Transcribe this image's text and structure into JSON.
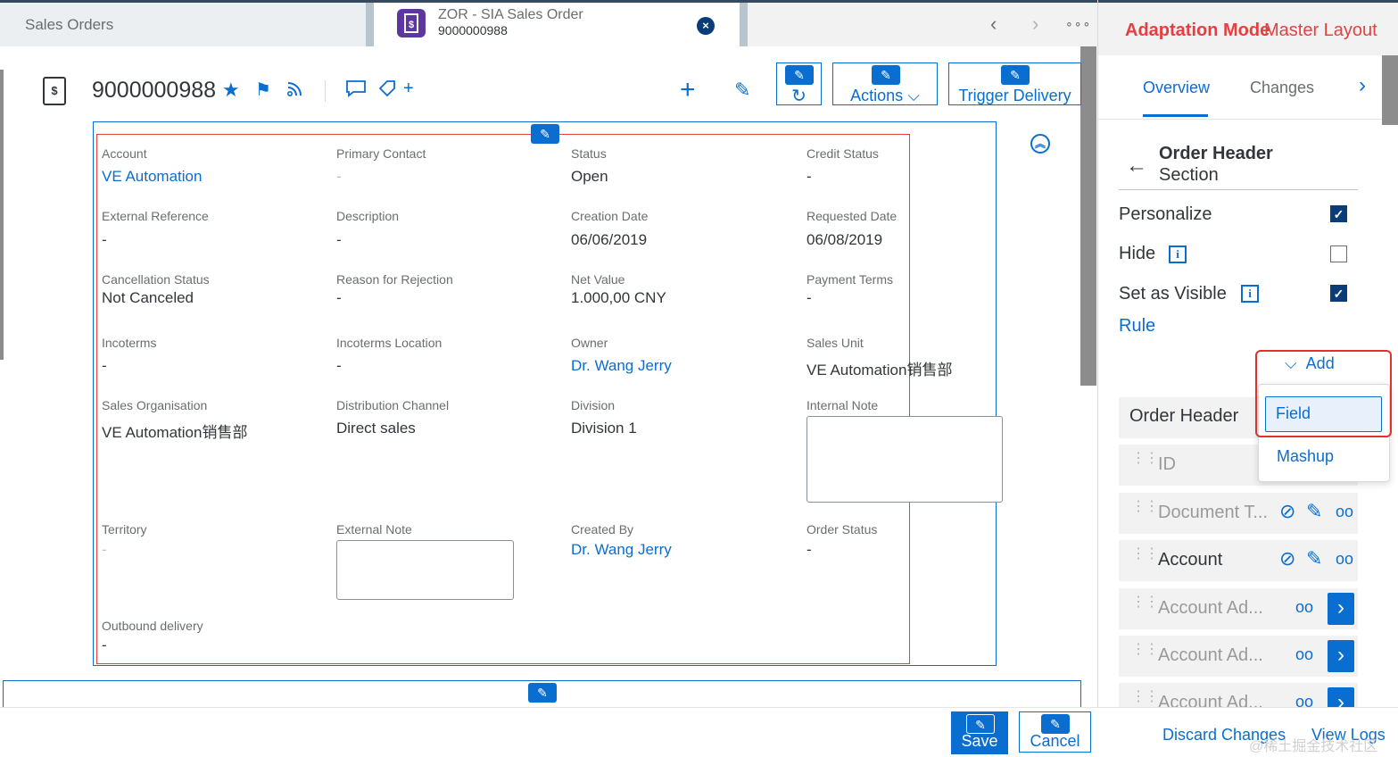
{
  "shell": {
    "tab_sales_orders": "Sales Orders",
    "active_tab_title": "ZOR - SIA Sales Order",
    "active_tab_subtitle": "9000000988"
  },
  "object": {
    "title": "9000000988",
    "actions_label": "Actions",
    "trigger_delivery_label": "Trigger Delivery"
  },
  "fields": [
    {
      "label": "Account",
      "value": "VE Automation",
      "link": true
    },
    {
      "label": "Primary Contact",
      "value": "-",
      "dim": true
    },
    {
      "label": "Status",
      "value": "Open"
    },
    {
      "label": "Credit Status",
      "value": "-"
    },
    {
      "label": "External Reference",
      "value": "-"
    },
    {
      "label": "Description",
      "value": "-"
    },
    {
      "label": "Creation Date",
      "value": "06/06/2019"
    },
    {
      "label": "Requested Date",
      "value": "06/08/2019"
    },
    {
      "label": "Cancellation Status",
      "value": "Not Canceled"
    },
    {
      "label": "Reason for Rejection",
      "value": "-"
    },
    {
      "label": "Net Value",
      "value": "1.000,00  CNY"
    },
    {
      "label": "Payment Terms",
      "value": "-"
    },
    {
      "label": "Incoterms",
      "value": "-"
    },
    {
      "label": "Incoterms Location",
      "value": "-"
    },
    {
      "label": "Owner",
      "value": "Dr. Wang Jerry",
      "link": true
    },
    {
      "label": "Sales Unit",
      "value": "VE Automation销售部"
    },
    {
      "label": "Sales Organisation",
      "value": "VE Automation销售部"
    },
    {
      "label": "Distribution Channel",
      "value": "Direct sales"
    },
    {
      "label": "Division",
      "value": "Division 1"
    },
    {
      "label": "Internal Note",
      "value": ""
    },
    {
      "label": "Territory",
      "value": "-",
      "dim": true
    },
    {
      "label": "External Note",
      "value": ""
    },
    {
      "label": "Created By",
      "value": "Dr. Wang Jerry",
      "link": true
    },
    {
      "label": "Order Status",
      "value": "-"
    },
    {
      "label": "Outbound delivery",
      "value": "-"
    }
  ],
  "footer": {
    "save_label": "Save",
    "cancel_label": "Cancel"
  },
  "panel": {
    "mode_label": "Adaptation Mode",
    "layout_label": "Master Layout",
    "tabs": [
      "Overview",
      "Changes"
    ],
    "section_title": "Order Header",
    "section_subtitle": "Section",
    "personalize_label": "Personalize",
    "personalize_checked": true,
    "hide_label": "Hide",
    "hide_checked": false,
    "visible_label": "Set as Visible",
    "visible_checked": true,
    "rule_label": "Rule",
    "add_label": "Add",
    "add_menu": [
      "Field",
      "Mashup"
    ],
    "group_label": "Order Header",
    "rows": [
      "ID",
      "Document T...",
      "Account",
      "Account Ad...",
      "Account Ad...",
      "Account Ad..."
    ],
    "discard_label": "Discard Changes",
    "view_logs_label": "View Logs",
    "watermark": "@稀土掘金技术社区"
  },
  "colors": {
    "accent": "#0a6ed1",
    "highlight_red": "#e0302f",
    "shell_bar": "#354a5f"
  }
}
